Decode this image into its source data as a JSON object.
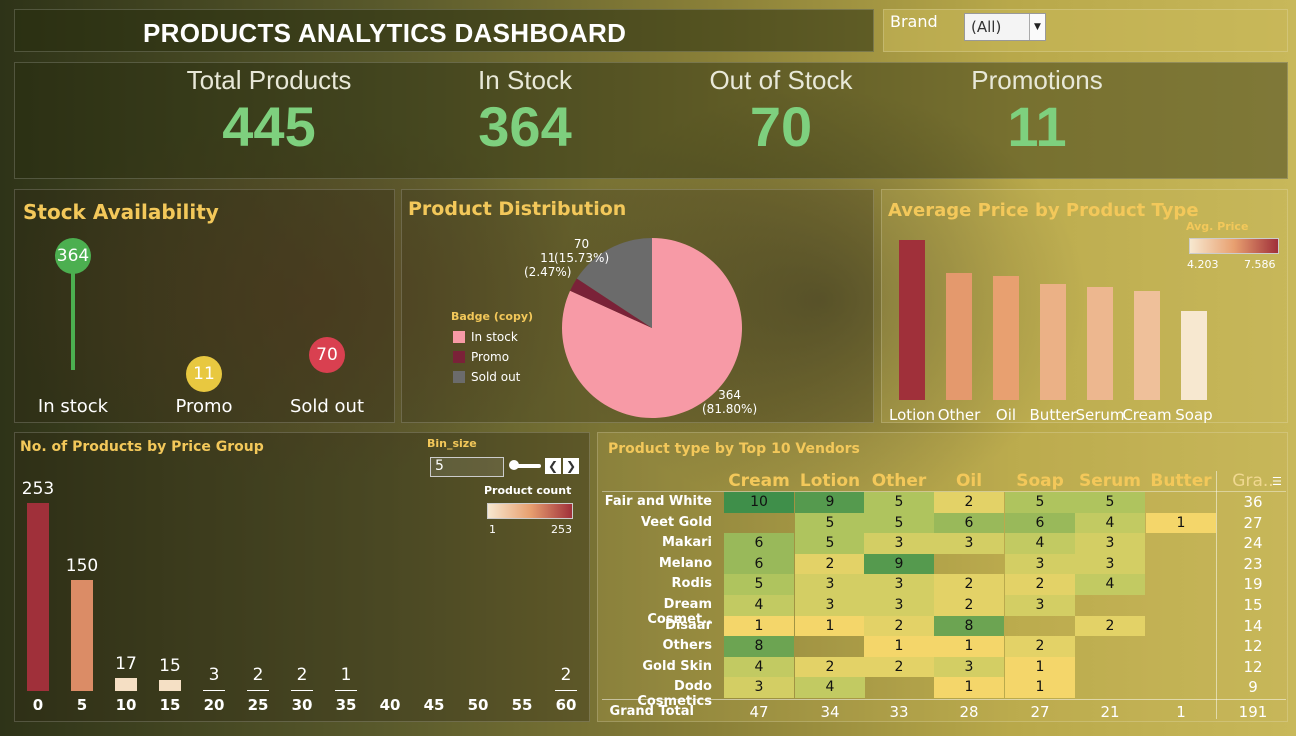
{
  "header": {
    "title": "PRODUCTS ANALYTICS DASHBOARD"
  },
  "brand_filter": {
    "label": "Brand",
    "value": "(All)"
  },
  "kpis": [
    {
      "label": "Total Products",
      "value": "445"
    },
    {
      "label": "In Stock",
      "value": "364"
    },
    {
      "label": "Out of Stock",
      "value": "70"
    },
    {
      "label": "Promotions",
      "value": "11"
    }
  ],
  "stock_availability": {
    "title": "Stock Availability",
    "items": [
      {
        "label": "In stock",
        "value": 364,
        "color": "#4caf50"
      },
      {
        "label": "Promo",
        "value": 11,
        "color": "#e8c840"
      },
      {
        "label": "Sold out",
        "value": 70,
        "color": "#d94050"
      }
    ]
  },
  "product_distribution": {
    "title": "Product Distribution",
    "legend_title": "Badge (copy)",
    "legend": [
      {
        "label": "In stock",
        "color": "#f79aa6"
      },
      {
        "label": "Promo",
        "color": "#7a2238"
      },
      {
        "label": "Sold out",
        "color": "#6b6b6b"
      }
    ],
    "labels": [
      {
        "value": "364",
        "pct": "(81.80%)"
      },
      {
        "value": "11",
        "pct": "(2.47%)"
      },
      {
        "value": "70",
        "pct": "(15.73%)"
      }
    ]
  },
  "avg_price": {
    "title": "Average Price by Product Type",
    "legend_title": "Avg. Price",
    "legend_min": "4.203",
    "legend_max": "7.586"
  },
  "price_group": {
    "title": "No. of Products by Price Group",
    "bin_label": "Bin_size",
    "bin_value": "5",
    "legend_title": "Product count",
    "legend_min": "1",
    "legend_max": "253"
  },
  "vendors": {
    "title": "Product type by Top 10 Vendors",
    "columns": [
      "Cream",
      "Lotion",
      "Other",
      "Oil",
      "Soap",
      "Serum",
      "Butter",
      "Gra.."
    ],
    "rows": [
      {
        "name": "Fair and White",
        "cells": [
          "10",
          "9",
          "5",
          "2",
          "5",
          "5",
          ""
        ],
        "total": "36"
      },
      {
        "name": "Veet Gold",
        "cells": [
          "",
          "5",
          "5",
          "6",
          "6",
          "4",
          "1"
        ],
        "total": "27"
      },
      {
        "name": "Makari",
        "cells": [
          "6",
          "5",
          "3",
          "3",
          "4",
          "3",
          ""
        ],
        "total": "24"
      },
      {
        "name": "Melano",
        "cells": [
          "6",
          "2",
          "9",
          "",
          "3",
          "3",
          ""
        ],
        "total": "23"
      },
      {
        "name": "Rodis",
        "cells": [
          "5",
          "3",
          "3",
          "2",
          "2",
          "4",
          ""
        ],
        "total": "19"
      },
      {
        "name": "Dream Cosmet..",
        "cells": [
          "4",
          "3",
          "3",
          "2",
          "3",
          "",
          ""
        ],
        "total": "15"
      },
      {
        "name": "Disaar",
        "cells": [
          "1",
          "1",
          "2",
          "8",
          "",
          "2",
          ""
        ],
        "total": "14"
      },
      {
        "name": "Others",
        "cells": [
          "8",
          "",
          "1",
          "1",
          "2",
          "",
          ""
        ],
        "total": "12"
      },
      {
        "name": "Gold Skin",
        "cells": [
          "4",
          "2",
          "2",
          "3",
          "1",
          "",
          ""
        ],
        "total": "12"
      },
      {
        "name": "Dodo Cosmetics",
        "cells": [
          "3",
          "4",
          "",
          "1",
          "1",
          "",
          ""
        ],
        "total": "9"
      }
    ],
    "grand_total_label": "Grand Total",
    "grand_totals": [
      "47",
      "34",
      "33",
      "28",
      "27",
      "21",
      "1",
      "191"
    ]
  },
  "chart_data": [
    {
      "type": "bar",
      "title": "Stock Availability",
      "categories": [
        "In stock",
        "Promo",
        "Sold out"
      ],
      "values": [
        364,
        11,
        70
      ]
    },
    {
      "type": "pie",
      "title": "Product Distribution",
      "categories": [
        "In stock",
        "Promo",
        "Sold out"
      ],
      "values": [
        364,
        11,
        70
      ],
      "percentages": [
        81.8,
        2.47,
        15.73
      ]
    },
    {
      "type": "bar",
      "title": "Average Price by Product Type",
      "categories": [
        "Lotion",
        "Other",
        "Oil",
        "Butter",
        "Serum",
        "Cream",
        "Soap"
      ],
      "values": [
        7.586,
        6.0,
        5.9,
        5.5,
        5.35,
        5.15,
        4.203
      ],
      "color_range": [
        4.203,
        7.586
      ]
    },
    {
      "type": "bar",
      "title": "No. of Products by Price Group",
      "categories": [
        "0",
        "5",
        "10",
        "15",
        "20",
        "25",
        "30",
        "35",
        "40",
        "45",
        "50",
        "55",
        "60"
      ],
      "values": [
        253,
        150,
        17,
        15,
        3,
        2,
        2,
        1,
        0,
        0,
        0,
        0,
        2
      ]
    }
  ]
}
